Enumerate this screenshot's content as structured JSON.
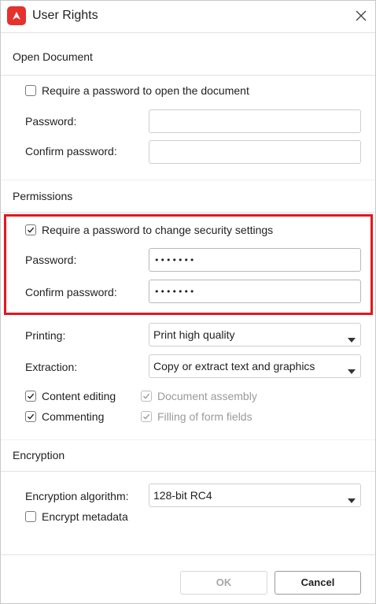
{
  "window": {
    "title": "User Rights",
    "app_icon": "app-logo-icon",
    "close_icon": "close-icon"
  },
  "open_document": {
    "heading": "Open Document",
    "require_password_label": "Require a password to open the document",
    "require_password_checked": false,
    "password_label": "Password:",
    "password_value": "",
    "confirm_label": "Confirm password:",
    "confirm_value": ""
  },
  "permissions": {
    "heading": "Permissions",
    "require_password_label": "Require a password to change security settings",
    "require_password_checked": true,
    "password_label": "Password:",
    "password_value": "•••••••",
    "confirm_label": "Confirm password:",
    "confirm_value": "•••••••",
    "printing_label": "Printing:",
    "printing_value": "Print high quality",
    "extraction_label": "Extraction:",
    "extraction_value": "Copy or extract text and graphics",
    "content_editing_label": "Content editing",
    "content_editing_checked": true,
    "document_assembly_label": "Document assembly",
    "document_assembly_checked": true,
    "commenting_label": "Commenting",
    "commenting_checked": true,
    "filling_forms_label": "Filling of form fields",
    "filling_forms_checked": true
  },
  "encryption": {
    "heading": "Encryption",
    "algorithm_label": "Encryption algorithm:",
    "algorithm_value": "128-bit RC4",
    "encrypt_metadata_label": "Encrypt metadata",
    "encrypt_metadata_checked": false
  },
  "buttons": {
    "ok_label": "OK",
    "cancel_label": "Cancel"
  },
  "colors": {
    "highlight": "#e5161d",
    "brand": "#e5322d"
  }
}
